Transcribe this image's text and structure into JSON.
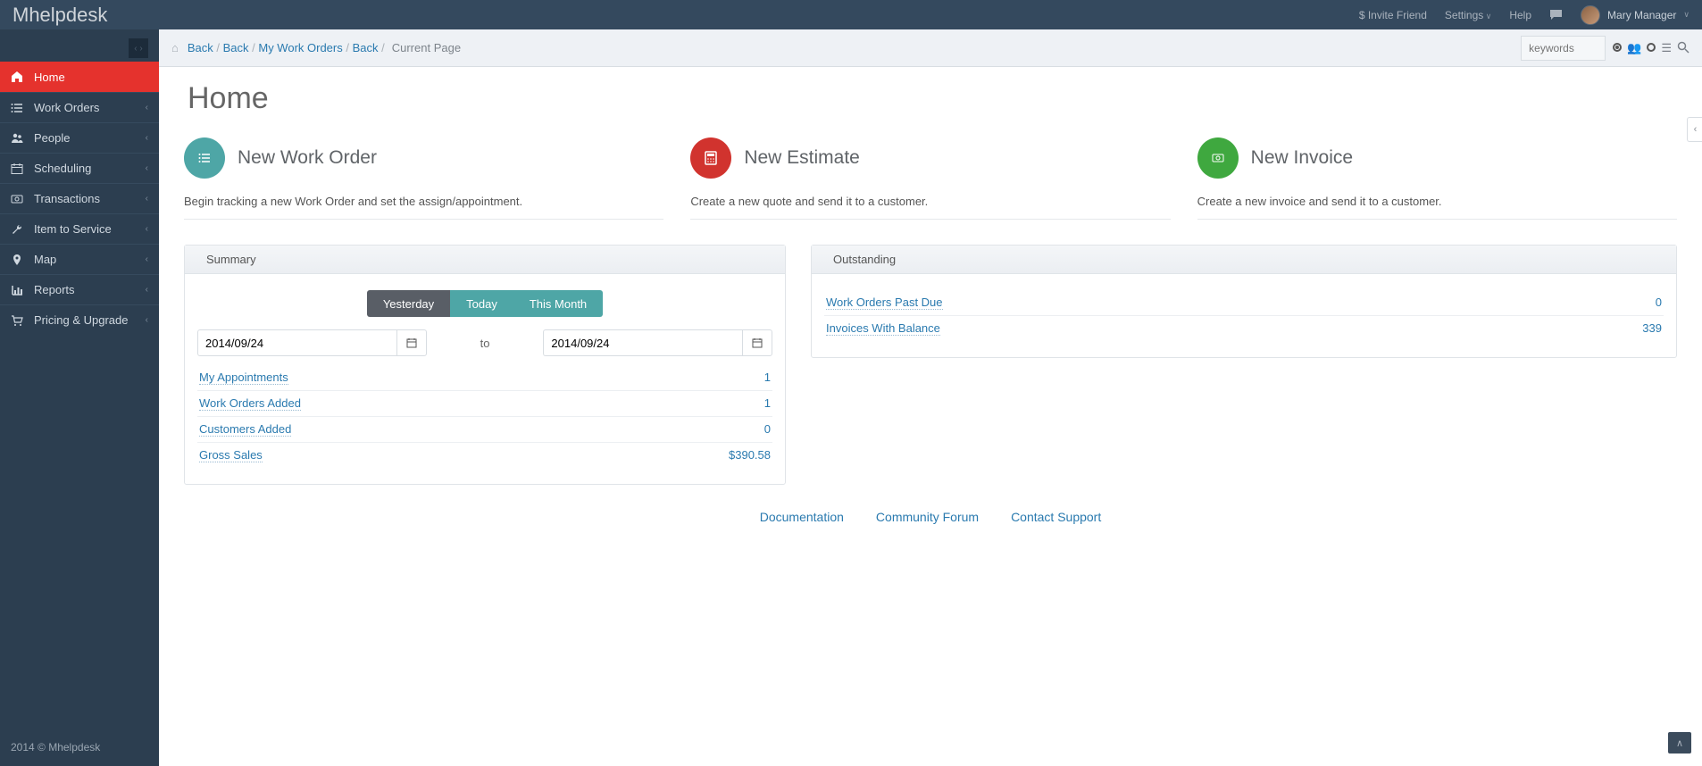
{
  "brand": "Mhelpdesk",
  "topnav": {
    "invite": "$ Invite Friend",
    "settings": "Settings",
    "help": "Help",
    "user": "Mary Manager"
  },
  "sidebar": {
    "items": [
      {
        "label": "Home",
        "icon": "home",
        "active": true,
        "expand": false
      },
      {
        "label": "Work Orders",
        "icon": "list",
        "active": false,
        "expand": true
      },
      {
        "label": "People",
        "icon": "people",
        "active": false,
        "expand": true
      },
      {
        "label": "Scheduling",
        "icon": "calendar",
        "active": false,
        "expand": true
      },
      {
        "label": "Transactions",
        "icon": "money",
        "active": false,
        "expand": true
      },
      {
        "label": "Item to Service",
        "icon": "wrench",
        "active": false,
        "expand": true
      },
      {
        "label": "Map",
        "icon": "pin",
        "active": false,
        "expand": true
      },
      {
        "label": "Reports",
        "icon": "chart",
        "active": false,
        "expand": true
      },
      {
        "label": "Pricing & Upgrade",
        "icon": "cart",
        "active": false,
        "expand": true
      }
    ],
    "footer": "2014 © Mhelpdesk"
  },
  "breadcrumb": {
    "items": [
      "Back",
      "Back",
      "My Work Orders",
      "Back"
    ],
    "current": "Current Page"
  },
  "search": {
    "placeholder": "keywords"
  },
  "page_title": "Home",
  "cards": [
    {
      "title": "New Work Order",
      "desc": "Begin tracking a new Work Order and set the assign/appointment.",
      "color": "teal",
      "icon": "list"
    },
    {
      "title": "New Estimate",
      "desc": "Create a new quote and send it to a customer.",
      "color": "red",
      "icon": "calc"
    },
    {
      "title": "New Invoice",
      "desc": "Create a new invoice and send it to a customer.",
      "color": "green",
      "icon": "money"
    }
  ],
  "summary": {
    "header": "Summary",
    "range_buttons": [
      "Yesterday",
      "Today",
      "This Month"
    ],
    "active_range_index": 0,
    "date_from": "2014/09/24",
    "date_to_label": "to",
    "date_to": "2014/09/24",
    "rows": [
      {
        "label": "My Appointments",
        "value": "1"
      },
      {
        "label": "Work Orders Added",
        "value": "1"
      },
      {
        "label": "Customers Added",
        "value": "0"
      },
      {
        "label": "Gross Sales",
        "value": "$390.58"
      }
    ]
  },
  "outstanding": {
    "header": "Outstanding",
    "rows": [
      {
        "label": "Work Orders Past Due",
        "value": "0"
      },
      {
        "label": "Invoices With Balance",
        "value": "339"
      }
    ]
  },
  "footer_links": [
    "Documentation",
    "Community Forum",
    "Contact Support"
  ]
}
